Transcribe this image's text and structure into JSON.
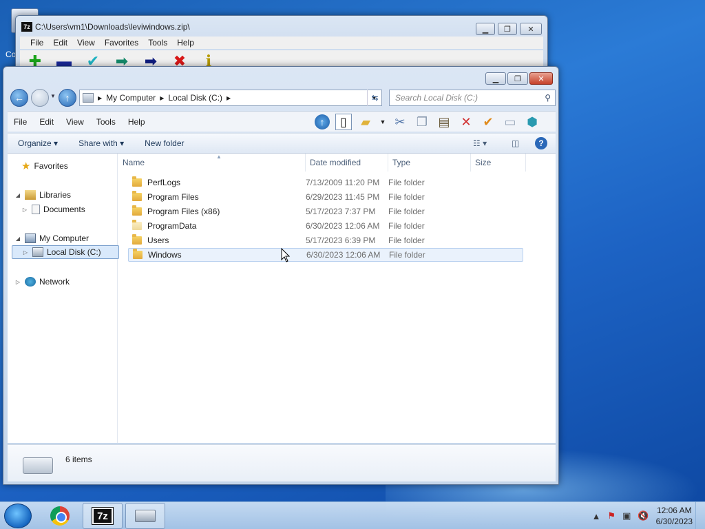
{
  "desktop": {
    "icon_label": "Co"
  },
  "zip_window": {
    "title": "C:\\Users\\vm1\\Downloads\\leviwindows.zip\\",
    "menu": [
      "File",
      "Edit",
      "View",
      "Favorites",
      "Tools",
      "Help"
    ],
    "tools": [
      {
        "icon": "add-icon",
        "glyph": "✚",
        "color": "#1aa31a"
      },
      {
        "icon": "extract-icon",
        "glyph": "▬",
        "color": "#1a2a9a"
      },
      {
        "icon": "test-icon",
        "glyph": "✔",
        "color": "#1fb3c2"
      },
      {
        "icon": "copy-icon",
        "glyph": "➡",
        "color": "#148a6a"
      },
      {
        "icon": "move-icon",
        "glyph": "➡",
        "color": "#101e80"
      },
      {
        "icon": "delete-icon",
        "glyph": "✖",
        "color": "#d81818"
      },
      {
        "icon": "info-icon",
        "glyph": "i",
        "color": "#b59a00"
      }
    ]
  },
  "explorer": {
    "breadcrumb": [
      "My Computer",
      "Local Disk (C:)"
    ],
    "search_placeholder": "Search Local Disk (C:)",
    "menu": [
      "File",
      "Edit",
      "View",
      "Tools",
      "Help"
    ],
    "commands": {
      "organize": "Organize",
      "share_with": "Share with",
      "new_folder": "New folder"
    },
    "nav": {
      "favorites": "Favorites",
      "libraries": "Libraries",
      "documents": "Documents",
      "my_computer": "My Computer",
      "local_disk": "Local Disk (C:)",
      "network": "Network"
    },
    "columns": {
      "name": "Name",
      "date": "Date modified",
      "type": "Type",
      "size": "Size"
    },
    "files": [
      {
        "name": "PerfLogs",
        "date": "7/13/2009 11:20 PM",
        "type": "File folder"
      },
      {
        "name": "Program Files",
        "date": "6/29/2023 11:45 PM",
        "type": "File folder"
      },
      {
        "name": "Program Files (x86)",
        "date": "5/17/2023 7:37 PM",
        "type": "File folder"
      },
      {
        "name": "ProgramData",
        "date": "6/30/2023 12:06 AM",
        "type": "File folder"
      },
      {
        "name": "Users",
        "date": "5/17/2023 6:39 PM",
        "type": "File folder"
      },
      {
        "name": "Windows",
        "date": "6/30/2023 12:06 AM",
        "type": "File folder"
      }
    ],
    "status": "6 items"
  },
  "taskbar": {
    "time": "12:06 AM",
    "date": "6/30/2023"
  },
  "colors": {
    "desktop": "#1d63c4",
    "selection": "#d9e9fb"
  }
}
